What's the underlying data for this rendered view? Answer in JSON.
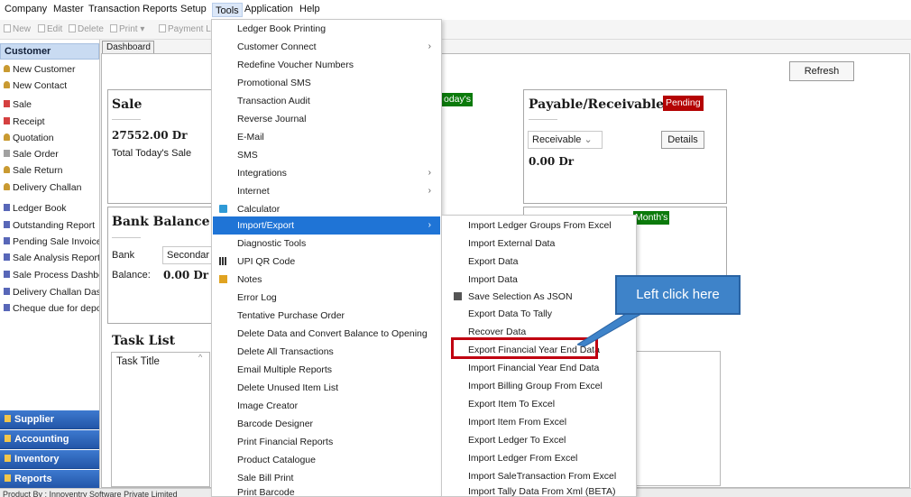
{
  "menubar": {
    "items": [
      "Company",
      "Master",
      "Transaction",
      "Reports",
      "Setup",
      "Tools",
      "Application",
      "Help"
    ]
  },
  "toolbar": {
    "new": "New",
    "edit": "Edit",
    "delete": "Delete",
    "print": "Print",
    "payment": "Payment L"
  },
  "sidebar": {
    "header": "Customer",
    "items": [
      "New Customer",
      "New Contact",
      "Sale",
      "Receipt",
      "Quotation",
      "Sale Order",
      "Sale Return",
      "Delivery Challan",
      "Ledger Book",
      "Outstanding Report",
      "Pending Sale Invoices",
      "Sale Analysis Report",
      "Sale Process Dashboa",
      "Delivery Challan Dashl",
      "Cheque due for depos"
    ],
    "groups": [
      "Supplier",
      "Accounting",
      "Inventory",
      "Reports"
    ]
  },
  "tab": {
    "label": "Dashboard"
  },
  "dashboard": {
    "refresh_label": "Refresh",
    "sale": {
      "title": "Sale",
      "amount": "27552.00 Dr",
      "caption": "Total Today's Sale"
    },
    "today_badge": "oday's",
    "payable": {
      "title": "Payable/Receivable",
      "badge": "Pending",
      "select": "Receivable",
      "details": "Details",
      "amount": "0.00 Dr"
    },
    "bank": {
      "title": "Bank Balance",
      "bank_label": "Bank",
      "bank_select": "Secondar",
      "balance_label": "Balance:",
      "balance_value": "0.00 Dr"
    },
    "month_badge": "Month's",
    "task": {
      "title": "Task List",
      "column": "Task Title"
    }
  },
  "tools_menu": {
    "items": [
      {
        "label": "Ledger Book Printing"
      },
      {
        "label": "Customer Connect",
        "submenu": true
      },
      {
        "label": "Redefine Voucher Numbers"
      },
      {
        "label": "Promotional SMS"
      },
      {
        "label": "Transaction Audit"
      },
      {
        "label": "Reverse Journal"
      },
      {
        "label": "E-Mail"
      },
      {
        "label": "SMS"
      },
      {
        "label": "Integrations",
        "submenu": true
      },
      {
        "label": "Internet",
        "submenu": true
      },
      {
        "label": "Calculator",
        "icon": "calculator-icon"
      },
      {
        "label": "Import/Export",
        "submenu": true,
        "highlighted": true
      },
      {
        "label": "Diagnostic Tools"
      },
      {
        "label": "UPI QR Code",
        "icon": "qr-code-icon"
      },
      {
        "label": "Notes",
        "icon": "notes-icon"
      },
      {
        "label": "Error Log"
      },
      {
        "label": "Tentative Purchase Order"
      },
      {
        "label": "Delete Data and Convert Balance to Opening"
      },
      {
        "label": "Delete All Transactions"
      },
      {
        "label": "Email Multiple Reports"
      },
      {
        "label": "Delete Unused Item List"
      },
      {
        "label": "Image Creator"
      },
      {
        "label": "Barcode Designer"
      },
      {
        "label": "Print Financial Reports"
      },
      {
        "label": "Product Catalogue"
      },
      {
        "label": "Sale Bill Print"
      },
      {
        "label": "Print Barcode"
      }
    ]
  },
  "import_export_menu": {
    "items": [
      {
        "label": "Import Ledger Groups From Excel"
      },
      {
        "label": "Import External Data"
      },
      {
        "label": "Export Data"
      },
      {
        "label": "Import Data"
      },
      {
        "label": "Save Selection As JSON",
        "icon": "save-icon"
      },
      {
        "label": "Export Data To Tally"
      },
      {
        "label": "Recover Data"
      },
      {
        "label": "Export Financial Year End Data",
        "highlighted_box": true
      },
      {
        "label": "Import Financial Year End Data"
      },
      {
        "label": "Import Billing Group From Excel"
      },
      {
        "label": "Export Item To Excel"
      },
      {
        "label": "Import Item From Excel"
      },
      {
        "label": "Export Ledger To Excel"
      },
      {
        "label": "Import Ledger From Excel"
      },
      {
        "label": "Import  SaleTransaction From Excel"
      },
      {
        "label": "Import Tally Data From Xml (BETA)"
      }
    ]
  },
  "callout": {
    "text": "Left click here"
  },
  "statusbar": {
    "text": "Product By : Innoventry Software Private Limited"
  },
  "colors": {
    "highlight": "#1f74d6",
    "callout": "#3e83c9",
    "target_border": "#c00010",
    "badge_green": "#0b7a0b",
    "badge_red": "#b40303"
  }
}
